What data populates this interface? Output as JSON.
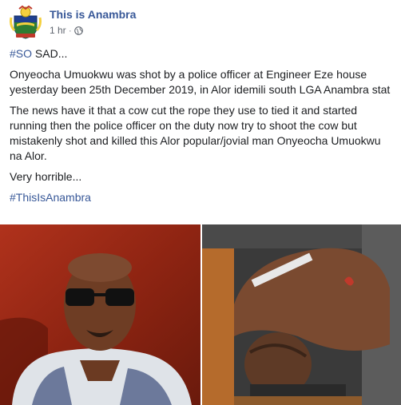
{
  "post": {
    "page_name": "This is Anambra",
    "time": "1 hr",
    "separator": "·",
    "hashtag_lead": "#SO",
    "lead_rest": " SAD...",
    "paragraph1": "Onyeocha Umuokwu was shot by a police officer at Engineer Eze house yesterday been 25th December 2019, in Alor idemili south LGA Anambra stat",
    "paragraph2": "The news have it that a cow cut the rope they use to tied it and started running then the police officer on the duty now try to shoot the cow but mistakenly shot and killed this Alor popular/jovial man Onyeocha Umuokwu na Alor.",
    "paragraph3": "Very horrible...",
    "hashtag_footer": "#ThisIsAnambra"
  },
  "icons": {
    "avatar": "anambra-crest-icon",
    "privacy": "globe-icon"
  },
  "colors": {
    "link": "#385898",
    "text": "#1c1e21",
    "meta": "#616770"
  }
}
